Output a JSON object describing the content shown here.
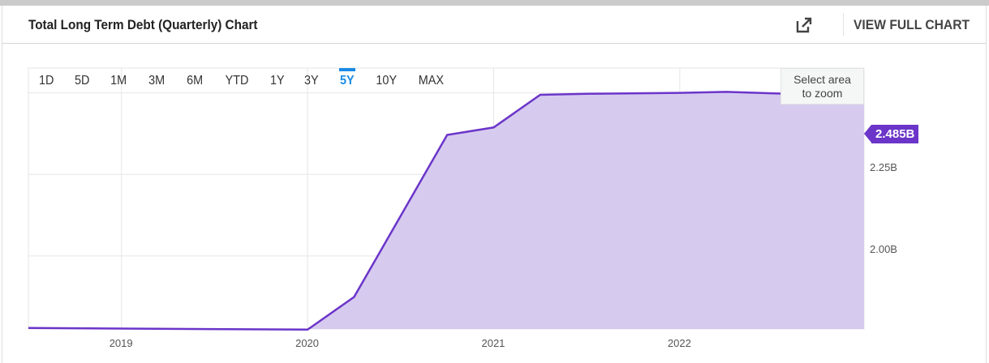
{
  "header": {
    "title": "Total Long Term Debt (Quarterly) Chart",
    "view_full": "VIEW FULL CHART",
    "external_icon": "external-link-icon"
  },
  "ranges": [
    "1D",
    "5D",
    "1M",
    "3M",
    "6M",
    "YTD",
    "1Y",
    "3Y",
    "5Y",
    "10Y",
    "MAX"
  ],
  "active_range": "5Y",
  "zoom_hint": {
    "line1": "Select area",
    "line2": "to zoom"
  },
  "colors": {
    "line": "#6b35c9",
    "fill": "#d6cbef",
    "accent": "#1a8be6"
  },
  "chart_data": {
    "type": "area",
    "title": "Total Long Term Debt (Quarterly) Chart",
    "x": [
      2018.5,
      2020.0,
      2020.25,
      2020.75,
      2021.0,
      2021.25,
      2021.5,
      2022.0,
      2022.25,
      2022.75,
      2022.99
    ],
    "values": [
      1.779,
      1.774,
      1.874,
      2.371,
      2.394,
      2.494,
      2.497,
      2.5,
      2.503,
      2.494,
      2.485
    ],
    "unit": "B",
    "last_label": "2.485B",
    "xlim": [
      2018.5,
      2022.99
    ],
    "ylim": [
      1.776,
      2.576
    ],
    "yticks": [
      {
        "v": 2.25,
        "label": "2.25B"
      },
      {
        "v": 2.0,
        "label": "2.00B"
      }
    ],
    "ygrid": [
      2.5,
      2.25,
      2.0
    ],
    "xticks": [
      {
        "v": 2019,
        "label": "2019"
      },
      {
        "v": 2020,
        "label": "2020"
      },
      {
        "v": 2021,
        "label": "2021"
      },
      {
        "v": 2022,
        "label": "2022"
      }
    ],
    "grid": true
  }
}
